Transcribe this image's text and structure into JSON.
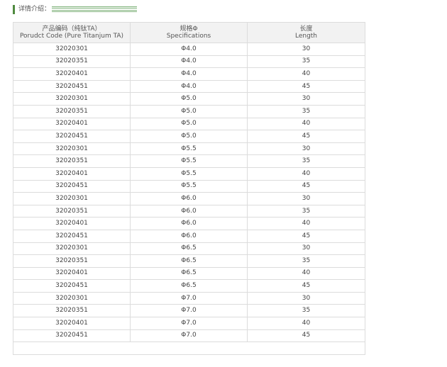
{
  "section": {
    "title": "详情介绍："
  },
  "table": {
    "headers": [
      {
        "zh": "产品编码（纯钛TA）",
        "en": "Porudct Code (Pure Titanjum TA)"
      },
      {
        "zh": "规格Φ",
        "en": "Specifications"
      },
      {
        "zh": "长度",
        "en": "Length"
      }
    ],
    "rows": [
      [
        "32020301",
        "Φ4.0",
        "30"
      ],
      [
        "32020351",
        "Φ4.0",
        "35"
      ],
      [
        "32020401",
        "Φ4.0",
        "40"
      ],
      [
        "32020451",
        "Φ4.0",
        "45"
      ],
      [
        "32020301",
        "Φ5.0",
        "30"
      ],
      [
        "32020351",
        "Φ5.0",
        "35"
      ],
      [
        "32020401",
        "Φ5.0",
        "40"
      ],
      [
        "32020451",
        "Φ5.0",
        "45"
      ],
      [
        "32020301",
        "Φ5.5",
        "30"
      ],
      [
        "32020351",
        "Φ5.5",
        "35"
      ],
      [
        "32020401",
        "Φ5.5",
        "40"
      ],
      [
        "32020451",
        "Φ5.5",
        "45"
      ],
      [
        "32020301",
        "Φ6.0",
        "30"
      ],
      [
        "32020351",
        "Φ6.0",
        "35"
      ],
      [
        "32020401",
        "Φ6.0",
        "40"
      ],
      [
        "32020451",
        "Φ6.0",
        "45"
      ],
      [
        "32020301",
        "Φ6.5",
        "30"
      ],
      [
        "32020351",
        "Φ6.5",
        "35"
      ],
      [
        "32020401",
        "Φ6.5",
        "40"
      ],
      [
        "32020451",
        "Φ6.5",
        "45"
      ],
      [
        "32020301",
        "Φ7.0",
        "30"
      ],
      [
        "32020351",
        "Φ7.0",
        "35"
      ],
      [
        "32020401",
        "Φ7.0",
        "40"
      ],
      [
        "32020451",
        "Φ7.0",
        "45"
      ]
    ]
  }
}
